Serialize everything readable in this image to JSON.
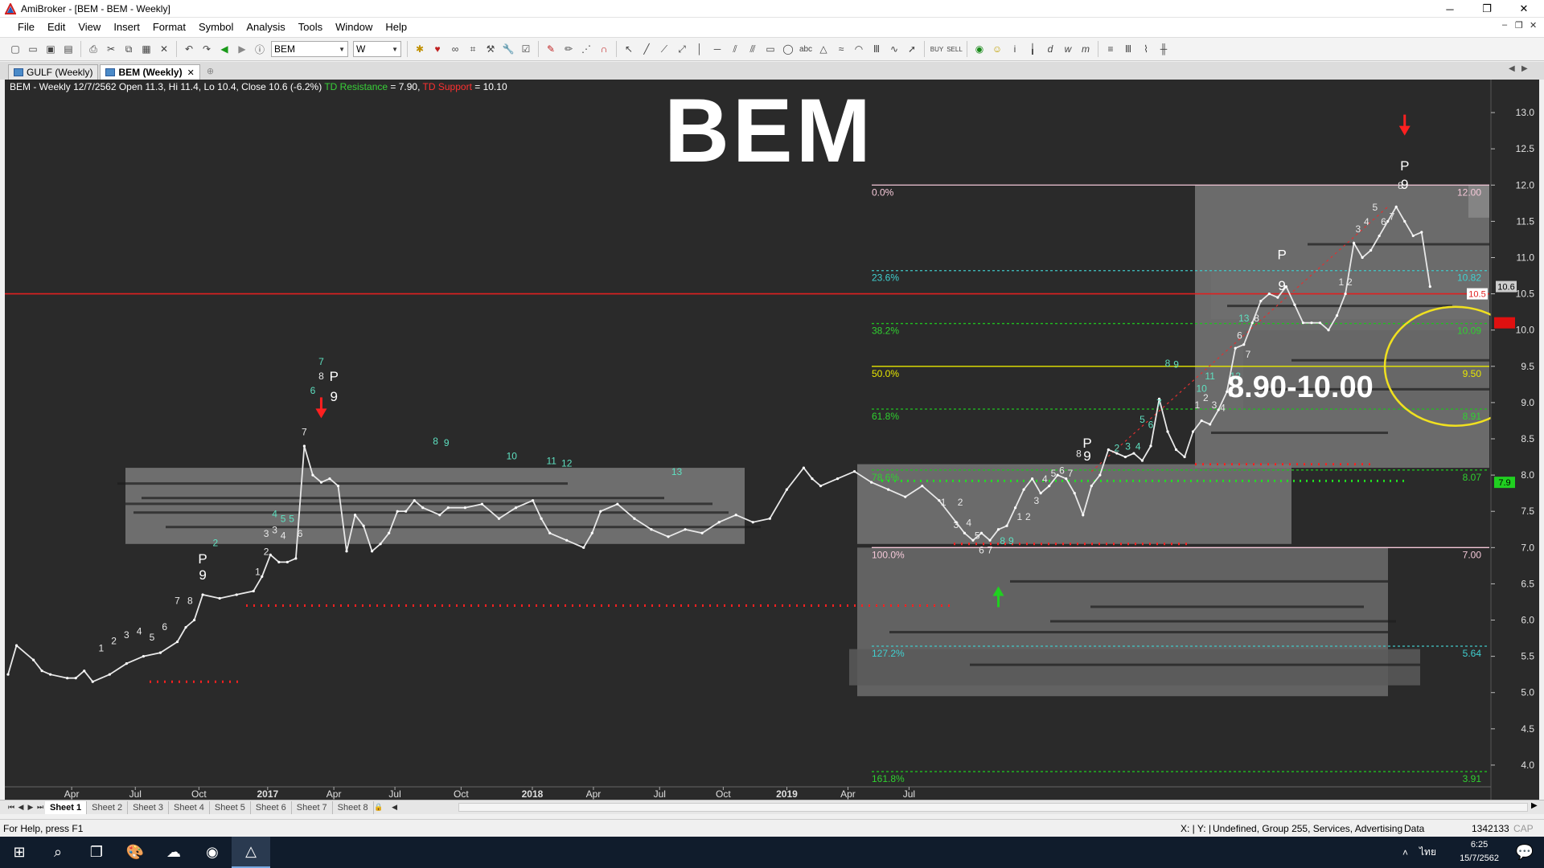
{
  "window": {
    "title": "AmiBroker - [BEM - BEM - Weekly]"
  },
  "window_controls": {
    "minimize": "─",
    "restore": "❐",
    "close": "✕"
  },
  "menu": [
    "File",
    "Edit",
    "View",
    "Insert",
    "Format",
    "Symbol",
    "Analysis",
    "Tools",
    "Window",
    "Help"
  ],
  "toolbar": {
    "symbol": "BEM",
    "interval": "W"
  },
  "tabs": [
    {
      "label": "GULF (Weekly)"
    },
    {
      "label": "BEM (Weekly)"
    }
  ],
  "chart": {
    "header_main": "BEM - Weekly 12/7/2562 Open 11.3, Hi 11.4, Lo 10.4, Close 10.6 (-6.2%)",
    "td_resistance_label": "TD Resistance",
    "td_resistance_value": " = 7.90,",
    "td_support_label": "TD Support",
    "td_support_value": " = 10.10",
    "big_title": "BEM",
    "zone_label": "8.90-10.00"
  },
  "sheets": [
    "Sheet 1",
    "Sheet 2",
    "Sheet 3",
    "Sheet 4",
    "Sheet 5",
    "Sheet 6",
    "Sheet 7",
    "Sheet 8"
  ],
  "status": {
    "help": "For Help, press F1",
    "xy": "X: | Y: |",
    "info": "Undefined, Group 255, Services, Advertising",
    "data": "Data",
    "mem": "1342133",
    "cap": "CAP"
  },
  "taskbar": {
    "time": "6:25",
    "date": "15/7/2562",
    "lang": "ไทย"
  },
  "colors": {
    "chart_bg": "#2a2a2a",
    "price_line": "#e8e8e8",
    "resistance": "#e02020",
    "fib_green": "#20c020",
    "fib_yellow": "#e8e800",
    "zone_ellipse": "#f0e020"
  },
  "chart_data": {
    "type": "line",
    "xaxis_labels": [
      "Apr",
      "Jul",
      "Oct",
      "2017",
      "Apr",
      "Jul",
      "Oct",
      "2018",
      "Apr",
      "Jul",
      "Oct",
      "2019",
      "Apr",
      "Jul"
    ],
    "y_ticks": [
      4.0,
      4.5,
      5.0,
      5.5,
      6.0,
      6.5,
      7.0,
      7.5,
      8.0,
      8.5,
      9.0,
      9.5,
      10.0,
      10.5,
      11.0,
      11.5,
      12.0,
      12.5,
      13.0
    ],
    "ylim": [
      3.7,
      13.3
    ],
    "weeks": 175,
    "price": [
      [
        0,
        5.25
      ],
      [
        1,
        5.65
      ],
      [
        3,
        5.45
      ],
      [
        4,
        5.3
      ],
      [
        5,
        5.25
      ],
      [
        7,
        5.2
      ],
      [
        8,
        5.2
      ],
      [
        9,
        5.3
      ],
      [
        10,
        5.15
      ],
      [
        12,
        5.25
      ],
      [
        14,
        5.4
      ],
      [
        16,
        5.5
      ],
      [
        18,
        5.55
      ],
      [
        20,
        5.7
      ],
      [
        21,
        5.9
      ],
      [
        22,
        6.0
      ],
      [
        23,
        6.35
      ],
      [
        25,
        6.3
      ],
      [
        27,
        6.35
      ],
      [
        29,
        6.4
      ],
      [
        30,
        6.6
      ],
      [
        31,
        6.9
      ],
      [
        32,
        6.8
      ],
      [
        33,
        6.8
      ],
      [
        34,
        6.85
      ],
      [
        35,
        8.4
      ],
      [
        36,
        8.0
      ],
      [
        37,
        7.9
      ],
      [
        38,
        7.95
      ],
      [
        39,
        7.85
      ],
      [
        40,
        6.95
      ],
      [
        41,
        7.45
      ],
      [
        42,
        7.3
      ],
      [
        43,
        6.95
      ],
      [
        44,
        7.05
      ],
      [
        45,
        7.2
      ],
      [
        46,
        7.5
      ],
      [
        47,
        7.5
      ],
      [
        48,
        7.65
      ],
      [
        49,
        7.55
      ],
      [
        51,
        7.45
      ],
      [
        52,
        7.55
      ],
      [
        54,
        7.55
      ],
      [
        56,
        7.6
      ],
      [
        58,
        7.4
      ],
      [
        60,
        7.55
      ],
      [
        62,
        7.65
      ],
      [
        63,
        7.4
      ],
      [
        64,
        7.2
      ],
      [
        66,
        7.1
      ],
      [
        68,
        7.0
      ],
      [
        69,
        7.2
      ],
      [
        70,
        7.5
      ],
      [
        72,
        7.6
      ],
      [
        74,
        7.4
      ],
      [
        76,
        7.25
      ],
      [
        78,
        7.15
      ],
      [
        80,
        7.25
      ],
      [
        82,
        7.2
      ],
      [
        84,
        7.35
      ],
      [
        86,
        7.45
      ],
      [
        88,
        7.35
      ],
      [
        90,
        7.4
      ],
      [
        92,
        7.8
      ],
      [
        94,
        8.1
      ],
      [
        95,
        7.95
      ],
      [
        96,
        7.85
      ],
      [
        98,
        7.95
      ],
      [
        100,
        8.05
      ],
      [
        102,
        7.9
      ],
      [
        104,
        7.8
      ],
      [
        106,
        7.7
      ],
      [
        108,
        7.85
      ],
      [
        110,
        7.65
      ],
      [
        112,
        7.35
      ],
      [
        113,
        7.2
      ],
      [
        114,
        7.1
      ],
      [
        115,
        7.2
      ],
      [
        116,
        7.1
      ],
      [
        117,
        7.25
      ],
      [
        118,
        7.3
      ],
      [
        119,
        7.55
      ],
      [
        120,
        7.8
      ],
      [
        121,
        7.95
      ],
      [
        122,
        7.75
      ],
      [
        123,
        7.85
      ],
      [
        124,
        8.0
      ],
      [
        125,
        7.95
      ],
      [
        126,
        7.75
      ],
      [
        127,
        7.45
      ],
      [
        128,
        7.85
      ],
      [
        129,
        8.0
      ],
      [
        130,
        8.35
      ],
      [
        131,
        8.3
      ],
      [
        132,
        8.25
      ],
      [
        133,
        8.3
      ],
      [
        134,
        8.2
      ],
      [
        135,
        8.4
      ],
      [
        136,
        9.05
      ],
      [
        137,
        8.6
      ],
      [
        138,
        8.35
      ],
      [
        139,
        8.25
      ],
      [
        140,
        8.6
      ],
      [
        141,
        8.75
      ],
      [
        142,
        8.7
      ],
      [
        143,
        8.9
      ],
      [
        144,
        9.15
      ],
      [
        145,
        9.75
      ],
      [
        146,
        9.8
      ],
      [
        147,
        10.1
      ],
      [
        148,
        10.4
      ],
      [
        149,
        10.5
      ],
      [
        150,
        10.45
      ],
      [
        151,
        10.6
      ],
      [
        152,
        10.35
      ],
      [
        153,
        10.1
      ],
      [
        154,
        10.1
      ],
      [
        155,
        10.1
      ],
      [
        156,
        10.0
      ],
      [
        157,
        10.2
      ],
      [
        158,
        10.5
      ],
      [
        159,
        11.2
      ],
      [
        160,
        11.0
      ],
      [
        161,
        11.1
      ],
      [
        162,
        11.3
      ],
      [
        163,
        11.5
      ],
      [
        164,
        11.7
      ],
      [
        165,
        11.5
      ],
      [
        166,
        11.3
      ],
      [
        167,
        11.35
      ],
      [
        168,
        10.6
      ]
    ],
    "horizontal_lines": {
      "resistance": 10.5,
      "fib_levels": [
        {
          "label": "0.0%",
          "price": 12.0,
          "value_label": "12.00"
        },
        {
          "label": "23.6%",
          "price": 10.82,
          "value_label": "10.82"
        },
        {
          "label": "38.2%",
          "price": 10.09,
          "value_label": "10.09"
        },
        {
          "label": "50.0%",
          "price": 9.5,
          "value_label": "9.50"
        },
        {
          "label": "61.8%",
          "price": 8.91,
          "value_label": "8.91"
        },
        {
          "label": "78.6%",
          "price": 8.07,
          "value_label": "8.07"
        },
        {
          "label": "100.0%",
          "price": 7.0,
          "value_label": "7.00"
        },
        {
          "label": "127.2%",
          "price": 5.64,
          "value_label": "5.64"
        },
        {
          "label": "161.8%",
          "price": 3.91,
          "value_label": "3.91"
        }
      ]
    },
    "price_tags": [
      {
        "price": 10.6,
        "label": "10.6",
        "style": "gray"
      },
      {
        "price": 10.5,
        "label": "10.5",
        "style": "white"
      },
      {
        "price": 10.1,
        "label": "10.1",
        "style": "red"
      },
      {
        "price": 7.9,
        "label": "7.9",
        "style": "green"
      }
    ],
    "td_labels": [
      {
        "x": 11,
        "p": 5.57,
        "t": "1"
      },
      {
        "x": 12.5,
        "p": 5.67,
        "t": "2"
      },
      {
        "x": 14,
        "p": 5.75,
        "t": "3"
      },
      {
        "x": 15.5,
        "p": 5.8,
        "t": "4"
      },
      {
        "x": 17,
        "p": 5.72,
        "t": "5"
      },
      {
        "x": 18.5,
        "p": 5.86,
        "t": "6"
      },
      {
        "x": 20,
        "p": 6.22,
        "t": "7"
      },
      {
        "x": 21.5,
        "p": 6.22,
        "t": "8"
      },
      {
        "x": 23,
        "p": 6.78,
        "t": "P",
        "c": "#fff"
      },
      {
        "x": 23,
        "p": 6.56,
        "t": "9",
        "c": "#fff"
      },
      {
        "x": 24.5,
        "p": 7.02,
        "t": "2",
        "c": "#5ee0c0"
      },
      {
        "x": 29.5,
        "p": 6.62,
        "t": "1"
      },
      {
        "x": 30.5,
        "p": 6.9,
        "t": "2"
      },
      {
        "x": 30.5,
        "p": 7.15,
        "t": "3"
      },
      {
        "x": 31.5,
        "p": 7.2,
        "t": "3"
      },
      {
        "x": 32.5,
        "p": 7.12,
        "t": "4"
      },
      {
        "x": 31.5,
        "p": 7.42,
        "t": "4",
        "c": "#5ee0c0"
      },
      {
        "x": 32.5,
        "p": 7.35,
        "t": "5",
        "c": "#5ee0c0"
      },
      {
        "x": 33.5,
        "p": 7.35,
        "t": "5",
        "c": "#5ee0c0"
      },
      {
        "x": 34.5,
        "p": 7.15,
        "t": "6"
      },
      {
        "x": 35,
        "p": 8.55,
        "t": "7"
      },
      {
        "x": 36,
        "p": 9.12,
        "t": "6",
        "c": "#5ee0c0"
      },
      {
        "x": 37,
        "p": 9.32,
        "t": "8"
      },
      {
        "x": 37,
        "p": 9.52,
        "t": "7",
        "c": "#5ee0c0"
      },
      {
        "x": 38.5,
        "p": 9.3,
        "t": "P",
        "c": "#fff"
      },
      {
        "x": 38.5,
        "p": 9.02,
        "t": "9",
        "c": "#fff"
      },
      {
        "x": 50.5,
        "p": 8.42,
        "t": "8",
        "c": "#5ee0c0"
      },
      {
        "x": 51.8,
        "p": 8.4,
        "t": "9",
        "c": "#5ee0c0"
      },
      {
        "x": 59.5,
        "p": 8.22,
        "t": "10",
        "c": "#5ee0c0"
      },
      {
        "x": 64.2,
        "p": 8.15,
        "t": "11",
        "c": "#5ee0c0"
      },
      {
        "x": 66,
        "p": 8.12,
        "t": "12",
        "c": "#5ee0c0"
      },
      {
        "x": 79,
        "p": 8.0,
        "t": "13",
        "c": "#5ee0c0"
      },
      {
        "x": 110.5,
        "p": 7.58,
        "t": "1"
      },
      {
        "x": 112.5,
        "p": 7.58,
        "t": "2"
      },
      {
        "x": 112,
        "p": 7.27,
        "t": "3"
      },
      {
        "x": 113.5,
        "p": 7.3,
        "t": "4"
      },
      {
        "x": 114.5,
        "p": 7.12,
        "t": "5"
      },
      {
        "x": 115,
        "p": 6.92,
        "t": "6"
      },
      {
        "x": 116,
        "p": 6.92,
        "t": "7"
      },
      {
        "x": 117.5,
        "p": 7.05,
        "t": "8",
        "c": "#5ee0c0"
      },
      {
        "x": 118.5,
        "p": 7.05,
        "t": "9",
        "c": "#5ee0c0"
      },
      {
        "x": 119.5,
        "p": 7.38,
        "t": "1"
      },
      {
        "x": 120.5,
        "p": 7.38,
        "t": "2"
      },
      {
        "x": 121.5,
        "p": 7.6,
        "t": "3"
      },
      {
        "x": 122.5,
        "p": 7.9,
        "t": "4"
      },
      {
        "x": 123.5,
        "p": 7.98,
        "t": "5"
      },
      {
        "x": 124.5,
        "p": 8.02,
        "t": "6"
      },
      {
        "x": 125.5,
        "p": 7.98,
        "t": "7"
      },
      {
        "x": 126.5,
        "p": 8.25,
        "t": "8"
      },
      {
        "x": 127.5,
        "p": 8.38,
        "t": "P",
        "c": "#fff"
      },
      {
        "x": 127.5,
        "p": 8.2,
        "t": "9",
        "c": "#fff"
      },
      {
        "x": 131,
        "p": 8.33,
        "t": "2",
        "c": "#5ee0c0"
      },
      {
        "x": 132.3,
        "p": 8.35,
        "t": "3",
        "c": "#5ee0c0"
      },
      {
        "x": 133.5,
        "p": 8.35,
        "t": "4",
        "c": "#5ee0c0"
      },
      {
        "x": 134,
        "p": 8.72,
        "t": "5",
        "c": "#5ee0c0"
      },
      {
        "x": 135,
        "p": 8.65,
        "t": "6",
        "c": "#5ee0c0"
      },
      {
        "x": 136,
        "p": 8.95,
        "t": "7",
        "c": "#5ee0c0"
      },
      {
        "x": 137,
        "p": 9.5,
        "t": "8",
        "c": "#5ee0c0"
      },
      {
        "x": 138,
        "p": 9.48,
        "t": "9",
        "c": "#5ee0c0"
      },
      {
        "x": 140.5,
        "p": 8.92,
        "t": "1"
      },
      {
        "x": 141.5,
        "p": 9.02,
        "t": "2"
      },
      {
        "x": 142.5,
        "p": 8.92,
        "t": "3"
      },
      {
        "x": 143.5,
        "p": 8.88,
        "t": "4"
      },
      {
        "x": 144.5,
        "p": 9.08,
        "t": "5"
      },
      {
        "x": 145.5,
        "p": 9.88,
        "t": "6"
      },
      {
        "x": 146.5,
        "p": 9.62,
        "t": "7"
      },
      {
        "x": 147.5,
        "p": 10.12,
        "t": "8"
      },
      {
        "x": 141,
        "p": 9.15,
        "t": "10",
        "c": "#5ee0c0"
      },
      {
        "x": 142,
        "p": 9.32,
        "t": "11",
        "c": "#5ee0c0"
      },
      {
        "x": 145,
        "p": 9.32,
        "t": "12",
        "c": "#5ee0c0"
      },
      {
        "x": 146,
        "p": 10.12,
        "t": "13",
        "c": "#5ee0c0"
      },
      {
        "x": 150.5,
        "p": 10.98,
        "t": "P",
        "c": "#fff"
      },
      {
        "x": 150.5,
        "p": 10.55,
        "t": "9",
        "c": "#fff"
      },
      {
        "x": 157.5,
        "p": 10.62,
        "t": "1"
      },
      {
        "x": 158.5,
        "p": 10.62,
        "t": "2"
      },
      {
        "x": 159.5,
        "p": 11.35,
        "t": "3"
      },
      {
        "x": 160.5,
        "p": 11.45,
        "t": "4"
      },
      {
        "x": 161.5,
        "p": 11.65,
        "t": "5"
      },
      {
        "x": 162.5,
        "p": 11.45,
        "t": "6"
      },
      {
        "x": 163.5,
        "p": 11.52,
        "t": "7"
      },
      {
        "x": 164.5,
        "p": 11.95,
        "t": "8"
      },
      {
        "x": 165,
        "p": 12.2,
        "t": "P",
        "c": "#fff"
      },
      {
        "x": 165,
        "p": 11.95,
        "t": "9",
        "c": "#fff"
      }
    ],
    "arrows": [
      {
        "x": 37,
        "p": 8.85,
        "dir": "down",
        "c": "#ff2020"
      },
      {
        "x": 165,
        "p": 12.75,
        "dir": "down",
        "c": "#ff2020"
      },
      {
        "x": 117,
        "p": 6.4,
        "dir": "up",
        "c": "#20d020"
      }
    ]
  }
}
